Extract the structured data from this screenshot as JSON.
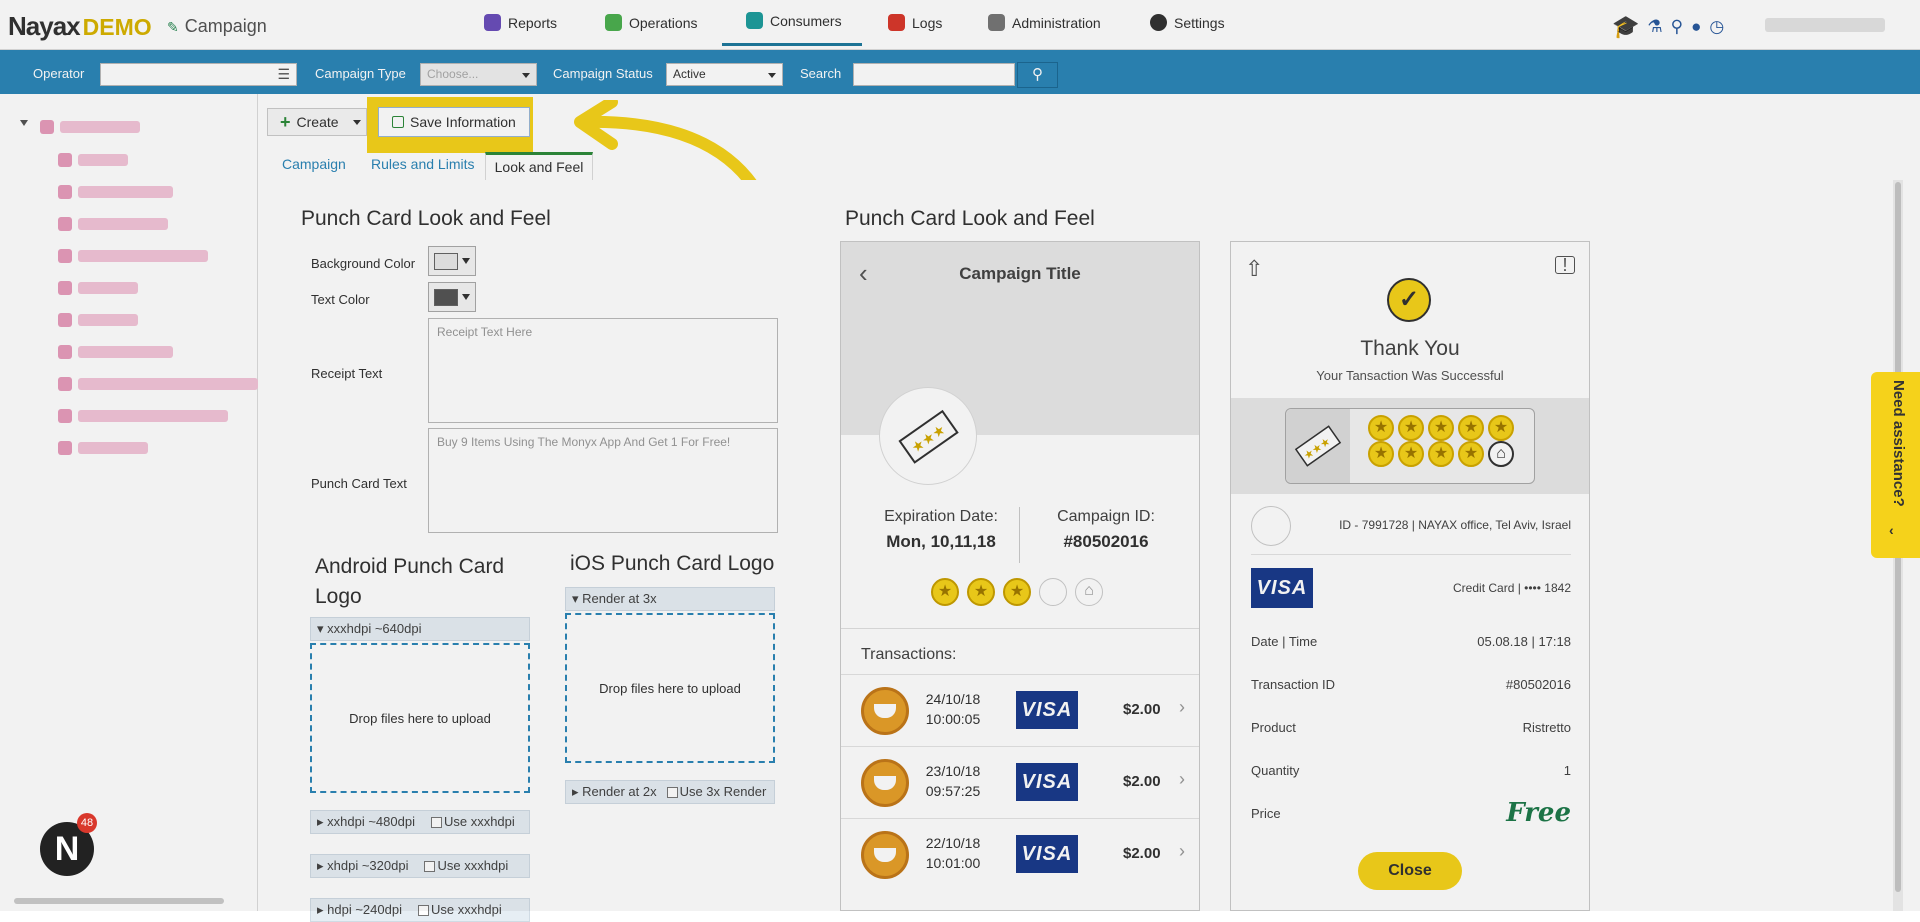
{
  "app": {
    "logo_main": "Nayax",
    "logo_demo": "DEMO",
    "module_title": "Campaign"
  },
  "nav": {
    "items": [
      {
        "label": "Reports",
        "color": "#6b4fbb"
      },
      {
        "label": "Operations",
        "color": "#4caf50"
      },
      {
        "label": "Consumers",
        "color": "#1f9e9e"
      },
      {
        "label": "Logs",
        "color": "#d9382c"
      },
      {
        "label": "Administration",
        "color": "#777777"
      },
      {
        "label": "Settings",
        "color": "#333333"
      }
    ],
    "active": "Consumers"
  },
  "filters": {
    "operator_label": "Operator",
    "campaign_type_label": "Campaign Type",
    "campaign_type_placeholder": "Choose...",
    "campaign_status_label": "Campaign Status",
    "campaign_status_value": "Active",
    "search_label": "Search"
  },
  "toolbar": {
    "create_label": "Create",
    "save_label": "Save Information"
  },
  "tabs": {
    "campaign": "Campaign",
    "rules": "Rules and Limits",
    "look": "Look and Feel"
  },
  "form": {
    "section_title": "Punch Card Look and Feel",
    "background_color_label": "Background Color",
    "background_color": "#e8e8e8",
    "text_color_label": "Text Color",
    "text_color": "#555555",
    "receipt_text_label": "Receipt Text",
    "receipt_text_placeholder": "Receipt Text Here",
    "punch_card_text_label": "Punch Card Text",
    "punch_card_text_placeholder": "Buy 9 Items Using The Monyx App And Get 1 For Free!",
    "android_title": "Android Punch Card Logo",
    "ios_title": "iOS Punch Card Logo",
    "android_sections": [
      {
        "label": "xxxhdpi ~640dpi"
      },
      {
        "label": "xxhdpi ~480dpi",
        "use": "Use xxxhdpi"
      },
      {
        "label": "xhdpi ~320dpi",
        "use": "Use xxxhdpi"
      },
      {
        "label": "hdpi ~240dpi",
        "use": "Use xxxhdpi"
      }
    ],
    "ios_sections": [
      {
        "label": "Render at 3x"
      },
      {
        "label": "Render at 2x",
        "use": "Use 3x Render"
      }
    ],
    "drop_text": "Drop files here to upload"
  },
  "preview": {
    "section_title": "Punch Card Look and Feel",
    "campaign_title": "Campaign Title",
    "expiration_label": "Expiration Date:",
    "expiration_value": "Mon, 10,11,18",
    "campaign_id_label": "Campaign ID:",
    "campaign_id_value": "#80502016",
    "punches_filled": 3,
    "punches_total": 5,
    "transactions_label": "Transactions:",
    "transactions": [
      {
        "date": "24/10/18",
        "time": "10:00:05",
        "card": "VISA",
        "amount": "$2.00"
      },
      {
        "date": "23/10/18",
        "time": "09:57:25",
        "card": "VISA",
        "amount": "$2.00"
      },
      {
        "date": "22/10/18",
        "time": "10:01:00",
        "card": "VISA",
        "amount": "$2.00"
      }
    ]
  },
  "receipt": {
    "thank_you": "Thank You",
    "subtitle": "Your Tansaction Was Successful",
    "location": "ID - 7991728 | NAYAX office, Tel Aviv, Israel",
    "card_brand": "VISA",
    "card_text": "Credit Card | •••• 1842",
    "rows": [
      {
        "label": "Date | Time",
        "value": "05.08.18 | 17:18"
      },
      {
        "label": "Transaction ID",
        "value": "#80502016"
      },
      {
        "label": "Product",
        "value": "Ristretto"
      },
      {
        "label": "Quantity",
        "value": "1"
      },
      {
        "label": "Price",
        "value": "Free"
      }
    ],
    "close_label": "Close",
    "stars_filled": 9,
    "stars_total": 10
  },
  "assistance": {
    "label": "Need assistance?"
  },
  "notifications": {
    "count": "48"
  },
  "colors": {
    "brand_blue": "#2c86b8",
    "highlight_yellow": "#f5d21b",
    "free_green": "#1e7a4a"
  }
}
